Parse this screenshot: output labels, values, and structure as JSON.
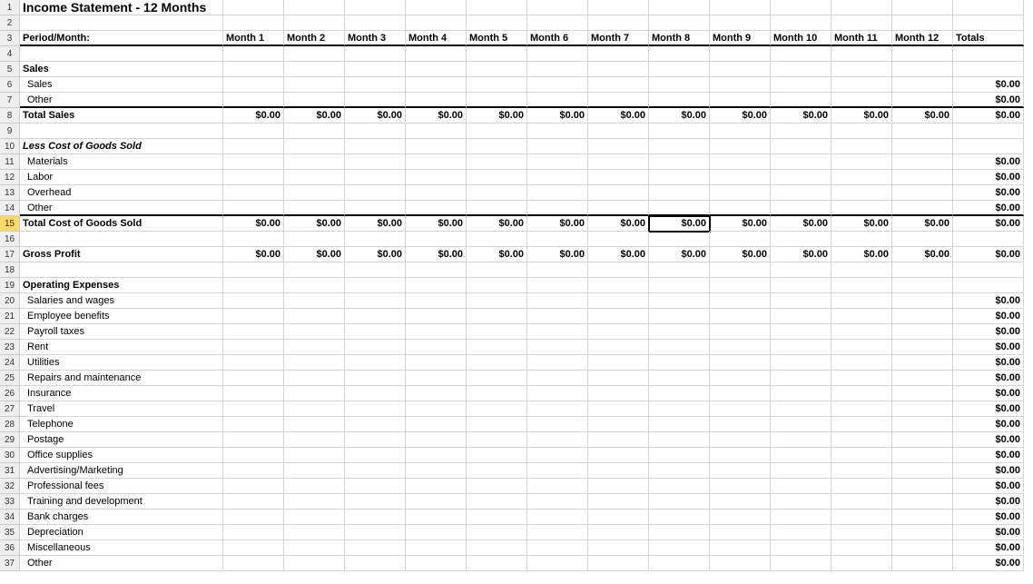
{
  "title": "Income Statement - 12 Months",
  "colA_header": "Period/Month:",
  "months": [
    "Month 1",
    "Month 2",
    "Month 3",
    "Month 4",
    "Month 5",
    "Month 6",
    "Month 7",
    "Month 8",
    "Month 9",
    "Month 10",
    "Month 11",
    "Month 12"
  ],
  "totals_label": "Totals",
  "zero": "$0.00",
  "active_cell": {
    "row": 15,
    "col": 9
  },
  "rows": [
    {
      "n": 1,
      "type": "title"
    },
    {
      "n": 2,
      "type": "blank"
    },
    {
      "n": 3,
      "type": "colheaders"
    },
    {
      "n": 4,
      "type": "blank"
    },
    {
      "n": 5,
      "type": "section",
      "label": "Sales"
    },
    {
      "n": 6,
      "type": "item",
      "label": "Sales",
      "total": "$0.00"
    },
    {
      "n": 7,
      "type": "item",
      "label": "Other",
      "total": "$0.00",
      "bottom_thick": true
    },
    {
      "n": 8,
      "type": "totalrow",
      "label": "Total Sales"
    },
    {
      "n": 9,
      "type": "blank"
    },
    {
      "n": 10,
      "type": "section_italic",
      "label": "Less Cost of Goods Sold"
    },
    {
      "n": 11,
      "type": "item",
      "label": "Materials",
      "total": "$0.00"
    },
    {
      "n": 12,
      "type": "item",
      "label": "Labor",
      "total": "$0.00"
    },
    {
      "n": 13,
      "type": "item",
      "label": "Overhead",
      "total": "$0.00"
    },
    {
      "n": 14,
      "type": "item",
      "label": "Other",
      "total": "$0.00",
      "bottom_thick": true
    },
    {
      "n": 15,
      "type": "totalrow",
      "label": "Total Cost of Goods Sold",
      "highlight": true
    },
    {
      "n": 16,
      "type": "blank"
    },
    {
      "n": 17,
      "type": "totalrow",
      "label": "Gross Profit"
    },
    {
      "n": 18,
      "type": "blank"
    },
    {
      "n": 19,
      "type": "section",
      "label": "Operating Expenses"
    },
    {
      "n": 20,
      "type": "item",
      "label": "Salaries and wages",
      "total": "$0.00"
    },
    {
      "n": 21,
      "type": "item",
      "label": "Employee benefits",
      "total": "$0.00"
    },
    {
      "n": 22,
      "type": "item",
      "label": "Payroll taxes",
      "total": "$0.00"
    },
    {
      "n": 23,
      "type": "item",
      "label": "Rent",
      "total": "$0.00"
    },
    {
      "n": 24,
      "type": "item",
      "label": "Utilities",
      "total": "$0.00"
    },
    {
      "n": 25,
      "type": "item",
      "label": "Repairs and maintenance",
      "total": "$0.00"
    },
    {
      "n": 26,
      "type": "item",
      "label": "Insurance",
      "total": "$0.00"
    },
    {
      "n": 27,
      "type": "item",
      "label": "Travel",
      "total": "$0.00"
    },
    {
      "n": 28,
      "type": "item",
      "label": "Telephone",
      "total": "$0.00"
    },
    {
      "n": 29,
      "type": "item",
      "label": "Postage",
      "total": "$0.00"
    },
    {
      "n": 30,
      "type": "item",
      "label": "Office supplies",
      "total": "$0.00"
    },
    {
      "n": 31,
      "type": "item",
      "label": "Advertising/Marketing",
      "total": "$0.00"
    },
    {
      "n": 32,
      "type": "item",
      "label": "Professional fees",
      "total": "$0.00"
    },
    {
      "n": 33,
      "type": "item",
      "label": "Training and development",
      "total": "$0.00"
    },
    {
      "n": 34,
      "type": "item",
      "label": "Bank charges",
      "total": "$0.00"
    },
    {
      "n": 35,
      "type": "item",
      "label": "Depreciation",
      "total": "$0.00"
    },
    {
      "n": 36,
      "type": "item",
      "label": "Miscellaneous",
      "total": "$0.00"
    },
    {
      "n": 37,
      "type": "item",
      "label": "Other",
      "total": "$0.00"
    }
  ]
}
